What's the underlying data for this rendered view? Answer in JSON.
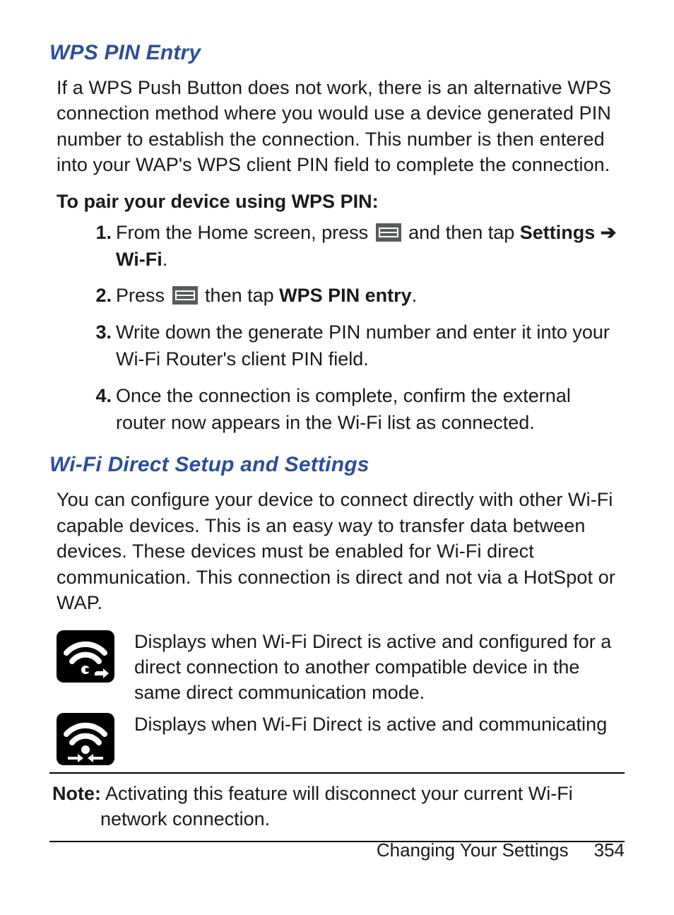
{
  "section1": {
    "heading": "WPS PIN Entry",
    "para": "If a WPS Push Button does not work, there is an alternative WPS connection method where you would use a device generated PIN number to establish the connection. This number is then entered into your WAP's WPS client PIN field to complete the connection.",
    "subheading": "To pair your device using WPS PIN:",
    "steps": {
      "s1a": "From the Home screen, press ",
      "s1b": " and then tap ",
      "s1_settings": "Settings",
      "s1_arrow": " ➔ ",
      "s1_wifi": "Wi-Fi",
      "s1_dot": ".",
      "s2a": "Press ",
      "s2b": " then tap ",
      "s2_bold": "WPS PIN entry",
      "s2_dot": ".",
      "s3": "Write down the generate PIN number and enter it into your Wi-Fi Router's client PIN field.",
      "s4": "Once the connection is complete, confirm the external router now appears in the Wi-Fi list as connected.",
      "nums": {
        "n1": "1.",
        "n2": "2.",
        "n3": "3.",
        "n4": "4."
      }
    }
  },
  "section2": {
    "heading": "Wi-Fi Direct Setup and Settings",
    "para": "You can configure your device to connect directly with other Wi-Fi capable devices. This is an easy way to transfer data between devices. These devices must be enabled for Wi-Fi direct communication. This connection is direct and not via a HotSpot or WAP.",
    "icon1_desc": "Displays when Wi-Fi Direct is active and configured for a direct connection to another compatible device in the same direct communication mode.",
    "icon2_desc": "Displays when Wi-Fi Direct is active and communicating"
  },
  "note": {
    "label": "Note:",
    "text_first": " Activating this feature will disconnect your current Wi-Fi",
    "text_rest": "network connection."
  },
  "footer": {
    "chapter": "Changing Your Settings",
    "page": "354"
  }
}
